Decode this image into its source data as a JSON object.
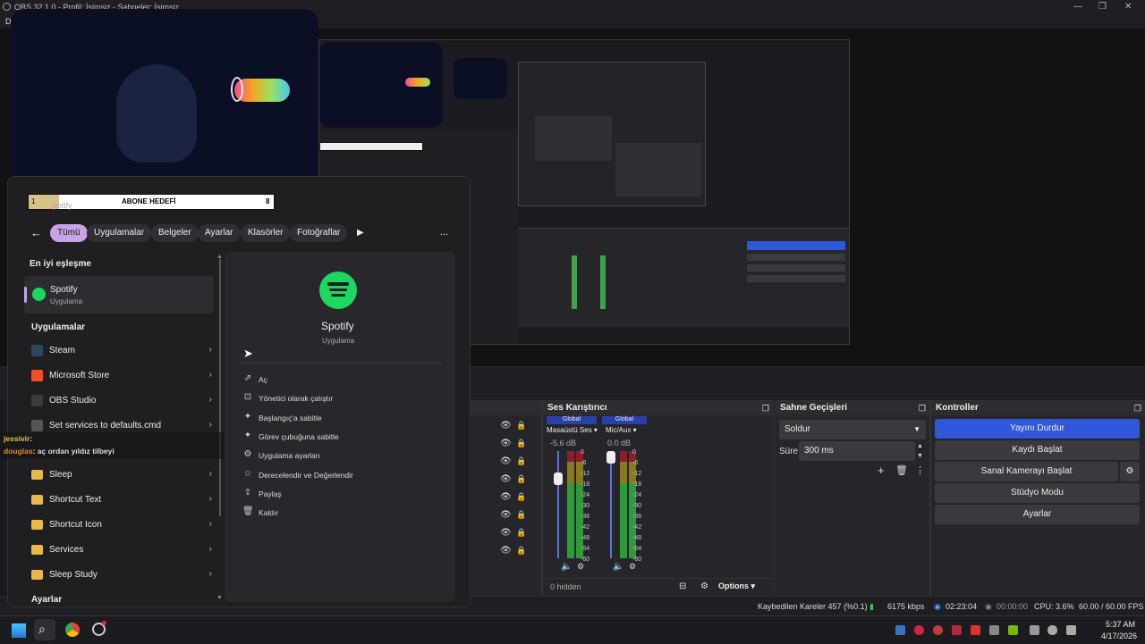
{
  "window": {
    "title": "OBS 32.1.0 - Profil: İsimsiz - Sahneler: İsimsiz"
  },
  "menu": {
    "first": "Dos",
    "last": "im"
  },
  "preview": {
    "goal_label": "ABONE HEDEFİ",
    "goal_left": "1",
    "goal_right": "8",
    "search_text": "potify"
  },
  "startmenu": {
    "filters": [
      "Tümü",
      "Uygulamalar",
      "Belgeler",
      "Ayarlar",
      "Klasörler",
      "Fotoğraflar"
    ],
    "more_label": "...",
    "best_match_heading": "En iyi eşleşme",
    "best_match": {
      "name": "Spotify",
      "sub": "Uygulama"
    },
    "apps_heading": "Uygulamalar",
    "apps": [
      {
        "name": "Steam",
        "color": "#2a475e"
      },
      {
        "name": "Microsoft Store",
        "color": "#f25022"
      },
      {
        "name": "OBS Studio",
        "color": "#3b3b3b"
      },
      {
        "name": "Set services to defaults.cmd",
        "color": "#555555"
      }
    ],
    "folders": [
      "Sleep",
      "Shortcut Text",
      "Shortcut Icon",
      "Services",
      "Sleep Study"
    ],
    "settings_heading": "Ayarlar",
    "detail": {
      "name": "Spotify",
      "sub": "Uygulama"
    },
    "actions": [
      {
        "icon": "open-icon",
        "glyph": "⇗",
        "label": "Aç"
      },
      {
        "icon": "admin-icon",
        "glyph": "⊡",
        "label": "Yönetici olarak çalıştır"
      },
      {
        "icon": "pin-start-icon",
        "glyph": "✦",
        "label": "Başlangıç'a sabitle"
      },
      {
        "icon": "pin-taskbar-icon",
        "glyph": "✦",
        "label": "Görev çubuğuna sabitle"
      },
      {
        "icon": "app-settings-icon",
        "glyph": "⚙",
        "label": "Uygulama ayarları"
      },
      {
        "icon": "rate-icon",
        "glyph": "☆",
        "label": "Derecelendir ve Değerlendir"
      },
      {
        "icon": "share-icon",
        "glyph": "⇪",
        "label": "Paylaş"
      },
      {
        "icon": "uninstall-icon",
        "glyph": "🗑",
        "label": "Kaldır"
      }
    ]
  },
  "chat": [
    {
      "user": "jessivir",
      "text": ": ",
      "color": "#f0c040"
    },
    {
      "user": "douglas",
      "text": ": aç ordan yıldız tilbeyi",
      "color": "#e08a30"
    }
  ],
  "mixer": {
    "title": "Ses Karıştırıcı",
    "channels": [
      {
        "tag": "Global",
        "name": "Masaüstü Ses",
        "db": "-5.6 dB",
        "level": 0.6
      },
      {
        "tag": "Global",
        "name": "Mic/Aux",
        "db": "0.0 dB",
        "level": 0.75
      }
    ],
    "ticks": [
      "0",
      "-6",
      "-12",
      "-18",
      "-24",
      "-30",
      "-36",
      "-42",
      "-48",
      "-54",
      "-60"
    ],
    "hidden_label": "0 hidden",
    "options_label": "Options"
  },
  "transitions": {
    "title": "Sahne Geçişleri",
    "selected": "Soldur",
    "duration_label": "Süre",
    "duration_value": "300 ms"
  },
  "controls": {
    "title": "Kontroller",
    "buttons": [
      "Yayını Durdur",
      "Kaydı Başlat",
      "Sanal Kamerayı Başlat",
      "Stüdyo Modu",
      "Ayarlar"
    ]
  },
  "status": {
    "dropped": "Kaybedilen Kareler 457 (%0.1)",
    "bitrate": "6175 kbps",
    "stream_time": "02:23:04",
    "rec_time": "00:00:00",
    "cpu": "CPU: 3.6%",
    "fps": "60.00 / 60.00 FPS"
  },
  "taskbar": {
    "time": "5:37 AM",
    "date": "4/17/2026"
  }
}
